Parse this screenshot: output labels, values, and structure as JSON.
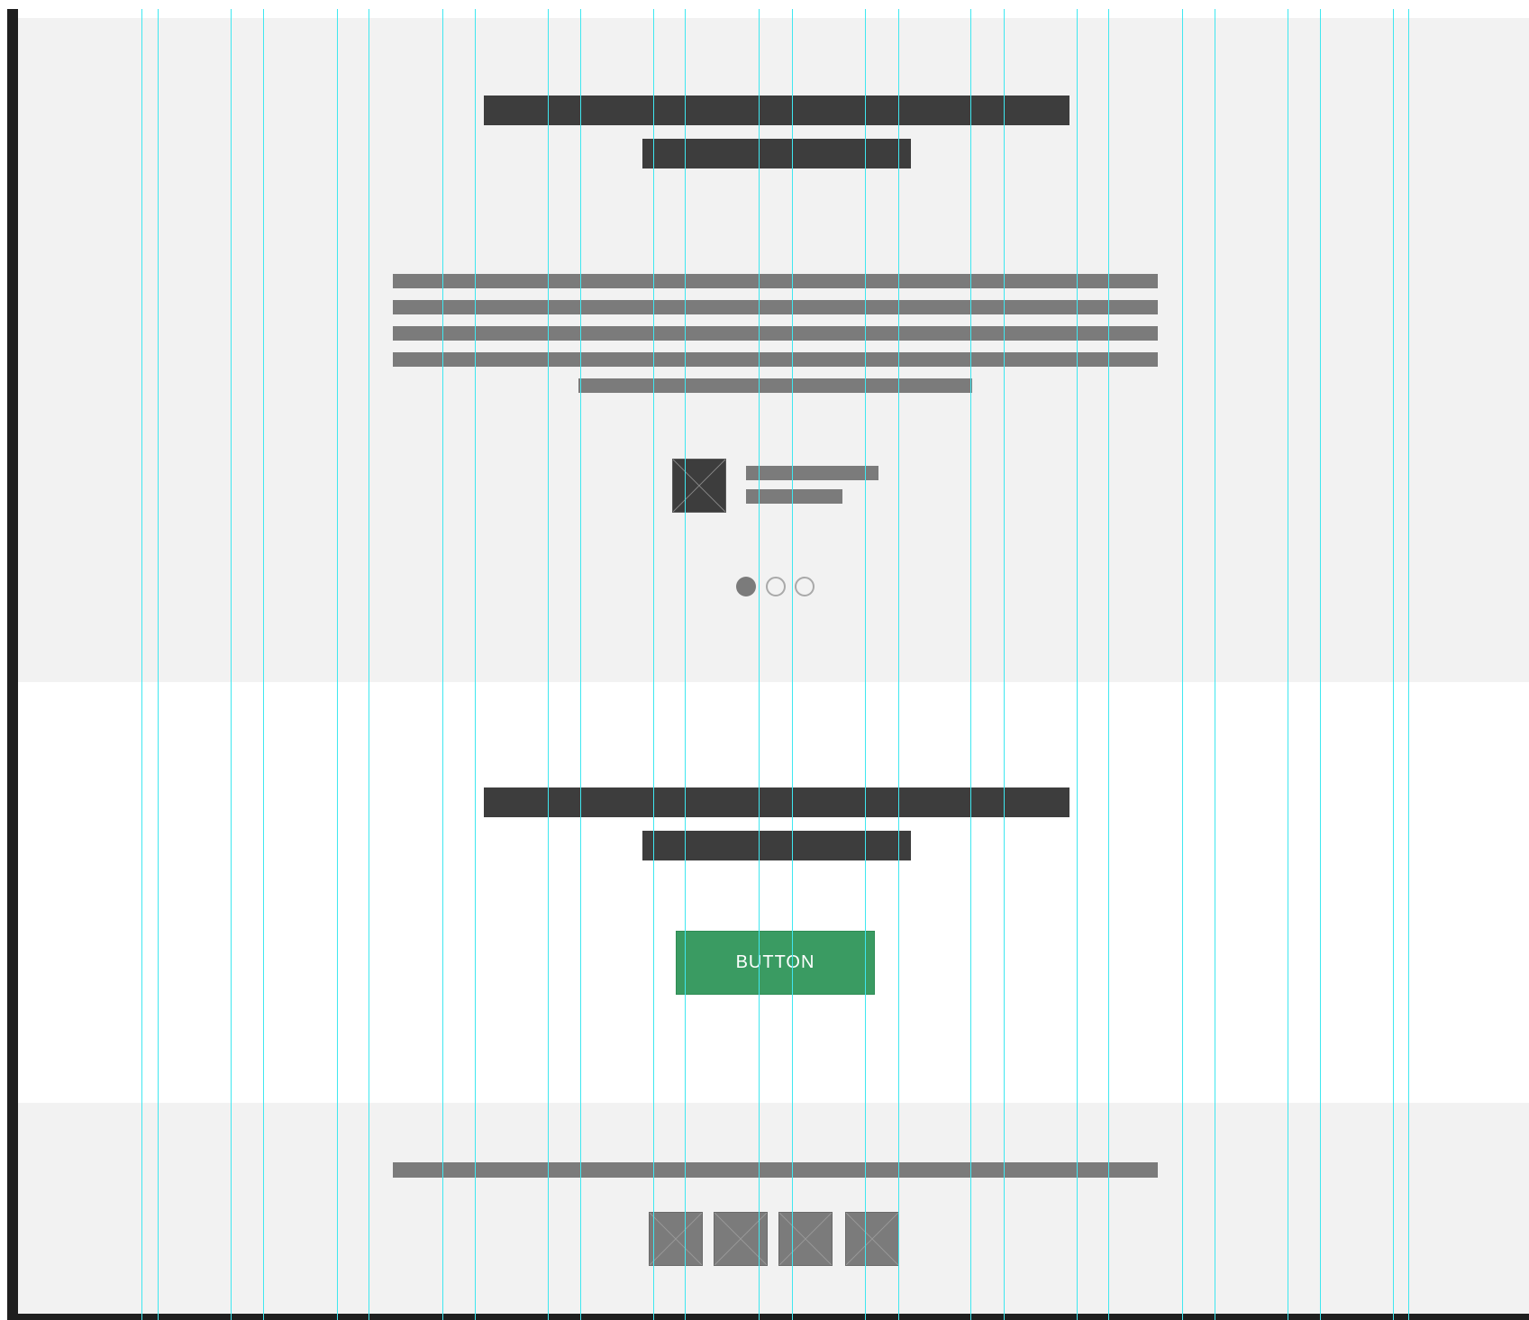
{
  "hero": {
    "headline_blocks": [
      "placeholder",
      "placeholder"
    ],
    "body_text_lines": 5,
    "carousel": {
      "total_slides": 3,
      "active_index": 0
    }
  },
  "cta": {
    "button_label": "BUTTON",
    "button_color": "#3a9b62"
  },
  "footer": {
    "social_icons": [
      "placeholder-icon",
      "placeholder-icon",
      "placeholder-icon",
      "placeholder-icon"
    ]
  },
  "colors": {
    "section_background": "#f2f2f2",
    "heading_block": "#3d3d3d",
    "text_block": "#7b7b7b",
    "grid_guide": "#3fe7f0"
  },
  "grid": {
    "columns": 12,
    "guides": 24
  }
}
